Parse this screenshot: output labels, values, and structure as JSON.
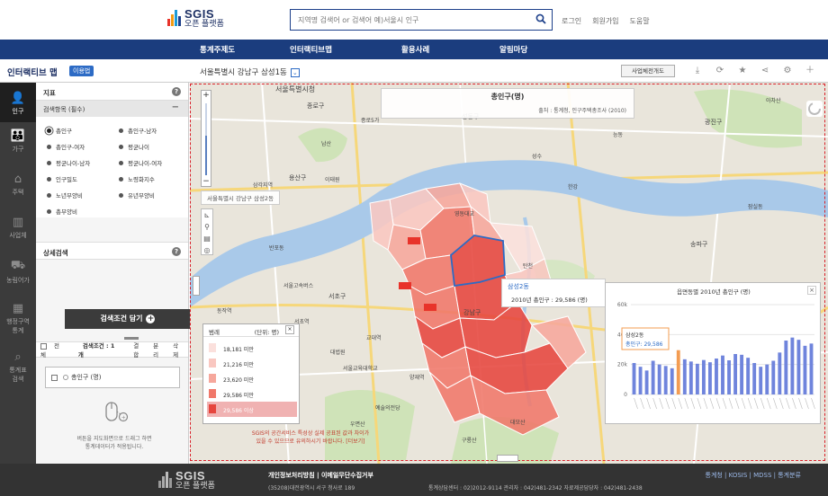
{
  "brand": {
    "logo_main": "SGIS",
    "logo_sub": "오픈 플랫폼",
    "colors": {
      "bar1": "#e8332a",
      "bar2": "#f39c12",
      "bar3": "#1c9ad6",
      "bar4": "#1c3f8a"
    }
  },
  "search": {
    "placeholder": "지역명 검색어 or 검색어 예)서울시 인구",
    "value": "",
    "icon": "search-icon"
  },
  "top_links": [
    "로그인",
    "회원가입",
    "도움말"
  ],
  "nav": [
    "통계주제도",
    "인터랙티브맵",
    "활용사례",
    "알림마당"
  ],
  "subbar": {
    "app_title": "인터랙티브 맵",
    "badge": "이용법",
    "location": "서울특별시 강남구 삼성1동",
    "biz_button": "사업체전개도",
    "icons": [
      "download-icon",
      "refresh-icon",
      "star-icon",
      "share-icon",
      "gear-icon",
      "plus-icon"
    ]
  },
  "icon_bar": [
    {
      "label": "인구",
      "icon": "person-icon"
    },
    {
      "label": "가구",
      "icon": "family-icon"
    },
    {
      "label": "주택",
      "icon": "house-icon"
    },
    {
      "label": "사업체",
      "icon": "building-icon"
    },
    {
      "label": "농림어가",
      "icon": "farm-icon"
    },
    {
      "label": "행정구역\n통계",
      "icon": "map-icon"
    },
    {
      "label": "통계표\n검색",
      "icon": "search-icon"
    }
  ],
  "panel": {
    "section_title": "지표",
    "required_header": "검색항목 (필수)",
    "options": [
      {
        "label": "총인구",
        "selected": true
      },
      {
        "label": "총인구-남자",
        "selected": false
      },
      {
        "label": "총인구-여자",
        "selected": false
      },
      {
        "label": "평균나이",
        "selected": false
      },
      {
        "label": "평균나이-남자",
        "selected": false
      },
      {
        "label": "평균나이-여자",
        "selected": false
      },
      {
        "label": "인구밀도",
        "selected": false
      },
      {
        "label": "노령화지수",
        "selected": false
      },
      {
        "label": "노년부양비",
        "selected": false
      },
      {
        "label": "유년부양비",
        "selected": false
      },
      {
        "label": "총부양비",
        "selected": false
      }
    ],
    "detail_title": "상세검색",
    "cond_button": "검색조건 담기",
    "cond_tabs": [
      "전체",
      "검색조건 : 1개",
      "결합",
      "분리",
      "삭제"
    ],
    "cond_item": "총인구 (명)",
    "help_text": "버튼을 지도화면으로 드래그 하면\n통계데이터가 적용됩니다."
  },
  "map": {
    "title": "총인구(명)",
    "source": "출처 : 통계청, 인구주택총조사 (2010)",
    "location_pill": "서울특별시 강남구 삼성2동",
    "labels": [
      {
        "text": "서울특별시청",
        "x": 95,
        "y": 10,
        "size": 8
      },
      {
        "text": "종로구",
        "x": 130,
        "y": 28,
        "size": 7
      },
      {
        "text": "종로5가",
        "x": 190,
        "y": 44,
        "size": 6
      },
      {
        "text": "남산",
        "x": 146,
        "y": 70,
        "size": 6
      },
      {
        "text": "용산구",
        "x": 110,
        "y": 108,
        "size": 7
      },
      {
        "text": "삼각지역",
        "x": 70,
        "y": 116,
        "size": 6
      },
      {
        "text": "이태원",
        "x": 150,
        "y": 110,
        "size": 6
      },
      {
        "text": "성동구",
        "x": 302,
        "y": 40,
        "size": 7
      },
      {
        "text": "성수",
        "x": 380,
        "y": 84,
        "size": 6
      },
      {
        "text": "광진구",
        "x": 572,
        "y": 46,
        "size": 7
      },
      {
        "text": "능동",
        "x": 470,
        "y": 60,
        "size": 6
      },
      {
        "text": "아차산",
        "x": 640,
        "y": 22,
        "size": 6
      },
      {
        "text": "송파구",
        "x": 556,
        "y": 182,
        "size": 7
      },
      {
        "text": "잠실동",
        "x": 620,
        "y": 140,
        "size": 6
      },
      {
        "text": "서초구",
        "x": 154,
        "y": 240,
        "size": 7
      },
      {
        "text": "반포동",
        "x": 88,
        "y": 186,
        "size": 6
      },
      {
        "text": "서울고속버스",
        "x": 104,
        "y": 228,
        "size": 6
      },
      {
        "text": "교대역",
        "x": 196,
        "y": 286,
        "size": 6
      },
      {
        "text": "서초역",
        "x": 116,
        "y": 268,
        "size": 6
      },
      {
        "text": "대법원",
        "x": 156,
        "y": 302,
        "size": 6
      },
      {
        "text": "서울교육대학교",
        "x": 170,
        "y": 320,
        "size": 6
      },
      {
        "text": "예술의전당",
        "x": 206,
        "y": 364,
        "size": 6
      },
      {
        "text": "우면산",
        "x": 178,
        "y": 382,
        "size": 6
      },
      {
        "text": "동작역",
        "x": 30,
        "y": 256,
        "size": 6
      },
      {
        "text": "강남구",
        "x": 304,
        "y": 258,
        "size": 7
      },
      {
        "text": "대모산",
        "x": 356,
        "y": 380,
        "size": 6
      },
      {
        "text": "구룡산",
        "x": 302,
        "y": 400,
        "size": 6
      },
      {
        "text": "양재역",
        "x": 244,
        "y": 330,
        "size": 6
      },
      {
        "text": "영동대교",
        "x": 294,
        "y": 148,
        "size": 6
      },
      {
        "text": "탄천",
        "x": 370,
        "y": 206,
        "size": 6
      },
      {
        "text": "한강",
        "x": 420,
        "y": 118,
        "size": 6
      }
    ],
    "legend": {
      "title": "범례",
      "unit": "(단위: 명)",
      "items": [
        {
          "label": "18,181 미만",
          "color": "#fbe0dc"
        },
        {
          "label": "21,216 미만",
          "color": "#f9c7c0"
        },
        {
          "label": "23,620 미만",
          "color": "#f6a79c"
        },
        {
          "label": "29,586 미만",
          "color": "#f0786a"
        },
        {
          "label": "29,586 이상",
          "color": "#e6453d"
        }
      ]
    },
    "warning": "SGIS의 공간서비스 특성상 실제 공표된 값과 차이가\n있을 수 있으므로 유의하시기 바랍니다. [더보기]",
    "tooltip": {
      "name": "삼성2동",
      "line_label": "2010년 총인구 :",
      "value": "29,586 (명)"
    }
  },
  "chart_data": {
    "type": "bar",
    "title": "읍면동별 2010년 총인구 (명)",
    "ylim": [
      0,
      60000
    ],
    "yticks": [
      "60k",
      "40k",
      "20k",
      "0"
    ],
    "highlight_index": 7,
    "highlight_label": "삼성2동",
    "highlight_series": "총인구",
    "highlight_value": "29,586",
    "values": [
      21000,
      18500,
      16000,
      22500,
      20000,
      19000,
      17500,
      29586,
      23500,
      22000,
      20500,
      23000,
      21500,
      24000,
      26000,
      22800,
      27000,
      26500,
      24500,
      21000,
      18500,
      20000,
      22500,
      28000,
      36000,
      38000,
      36500,
      32500,
      34000
    ],
    "colors": {
      "bar": "#6f84dc",
      "highlight": "#f39c52"
    }
  },
  "footer": {
    "line1": "개인정보처리방침  |  이메일무단수집거부",
    "line2": "(35208)대전광역시 서구 청사로 189",
    "right1": "통계청 | KOSIS | MDSS | 통계분류",
    "right2": "통계상담센터 : 02)2012-9114    관리자 : 042)481-2342    자료제공담당자 : 042)481-2438"
  }
}
